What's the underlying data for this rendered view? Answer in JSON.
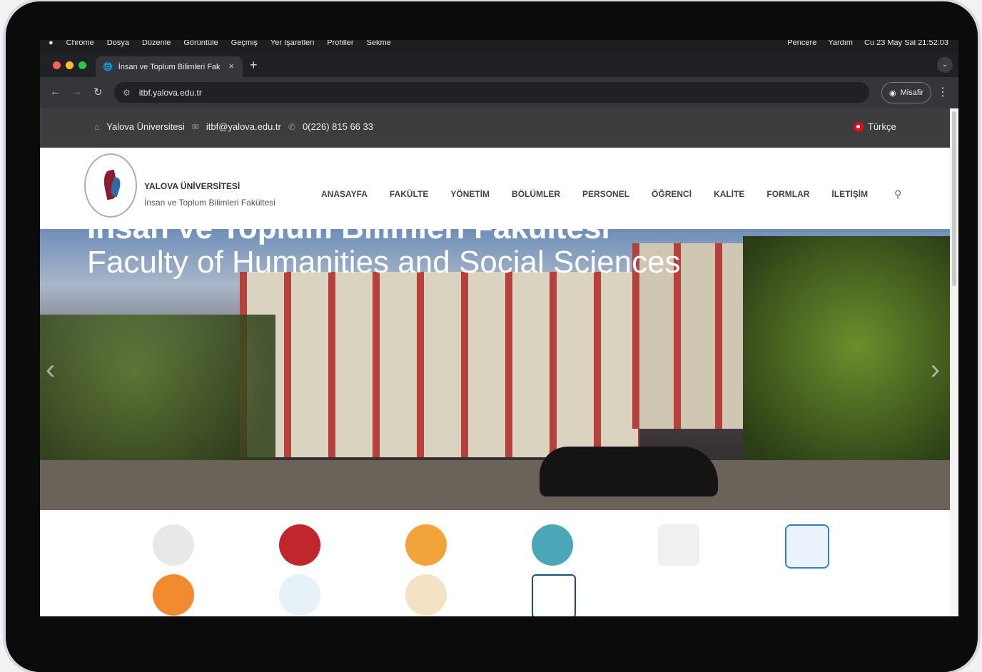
{
  "macos_menu": {
    "items": [
      "Chrome",
      "Dosya",
      "Düzenle",
      "Görüntüle",
      "Geçmiş",
      "Yer İşaretleri",
      "Profiller",
      "Sekme"
    ],
    "right_items": [
      "Pencere",
      "Yardım"
    ],
    "clock": "Cu 23 May Sal 21:52:03"
  },
  "browser": {
    "tab_title": "İnsan ve Toplum Bilimleri Fak",
    "url": "itbf.yalova.edu.tr",
    "profile_label": "Misafir"
  },
  "site_topbar": {
    "university": "Yalova Üniversitesi",
    "email": "itbf@yalova.edu.tr",
    "phone": "0(226) 815 66 33",
    "language": "Türkçe"
  },
  "site_header": {
    "brand_title": "YALOVA ÜNİVERSİTESİ",
    "brand_subtitle": "İnsan ve Toplum Bilimleri Fakültesi",
    "nav": [
      "ANASAYFA",
      "FAKÜLTE",
      "YÖNETİM",
      "BÖLÜMLER",
      "PERSONEL",
      "ÖĞRENCİ",
      "KALİTE",
      "FORMLAR",
      "İLETİŞİM"
    ]
  },
  "hero": {
    "title": "İnsan ve Toplum Bilimleri Fakültesi",
    "subtitle": "Faculty of Humanities and Social Sciences"
  },
  "icon_grid": {
    "icons": [
      {
        "name": "person-laptop-icon",
        "color": "#f2a33a"
      },
      {
        "name": "registered-icon",
        "color": "#c0272d"
      },
      {
        "name": "phone-chat-icon",
        "color": "#f2a33a"
      },
      {
        "name": "scroll-icon",
        "color": "#4aa7b8"
      },
      {
        "name": "monitor-icon",
        "color": "#333333"
      },
      {
        "name": "calendar-icon",
        "color": "#3a7bc8"
      },
      {
        "name": "clock-people-icon",
        "color": "#f28a30"
      },
      {
        "name": "globe-icon",
        "color": "#3a8ab5"
      },
      {
        "name": "sign-figure-icon",
        "color": "#d9b36a"
      },
      {
        "name": "certificate-icon",
        "color": "#1f4e79"
      }
    ]
  }
}
